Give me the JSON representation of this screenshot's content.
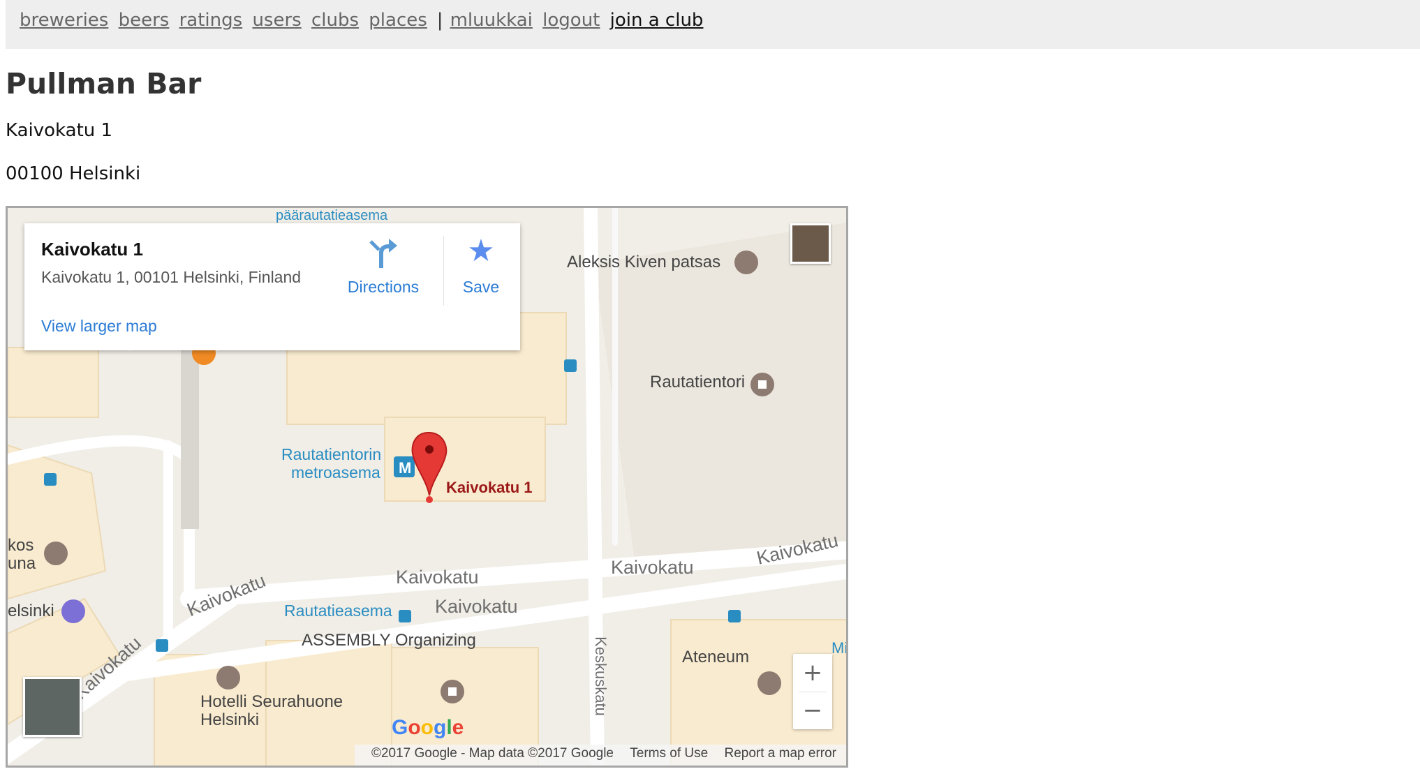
{
  "nav": {
    "links": [
      "breweries",
      "beers",
      "ratings",
      "users",
      "clubs",
      "places"
    ],
    "separator": "|",
    "user": "mluukkai",
    "logout": "logout",
    "join": "join a club"
  },
  "place": {
    "name": "Pullman Bar",
    "street": "Kaivokatu 1",
    "city": "00100 Helsinki"
  },
  "map": {
    "info_card": {
      "title": "Kaivokatu 1",
      "address": "Kaivokatu 1, 00101 Helsinki, Finland",
      "directions": "Directions",
      "save": "Save",
      "view_larger": "View larger map"
    },
    "marker_label": "Kaivokatu 1",
    "pois": {
      "aleksis": "Aleksis Kiven patsas",
      "rautatientori": "Rautatientori",
      "metro_1": "Rautatientorin",
      "metro_2": "metroasema",
      "rautatieasema": "Rautatieasema",
      "assembly": "ASSEMBLY Organizing",
      "ateneum": "Ateneum",
      "hotelli_1": "Hotelli Seurahuone",
      "hotelli_2": "Helsinki",
      "kos": "kos",
      "una": "una",
      "elsinki": "elsinki",
      "mi": "Mi",
      "paarautatieasema": "päärautatieasema"
    },
    "streets": {
      "kaivokatu": "Kaivokatu",
      "keskuskatu": "Keskuskatu"
    },
    "zoom_in": "+",
    "zoom_out": "−",
    "footer": {
      "copyright": "©2017 Google - Map data ©2017 Google",
      "terms": "Terms of Use",
      "report": "Report a map error"
    },
    "google_logo": "Google"
  },
  "colors": {
    "building": "#f9ebcf",
    "road": "#ffffff",
    "ground": "#f1eee7",
    "transit_blue": "#2a8dc2",
    "poi_brown": "#8d7a70",
    "marker_red": "#e53935",
    "link_blue": "#2a7bd4"
  }
}
